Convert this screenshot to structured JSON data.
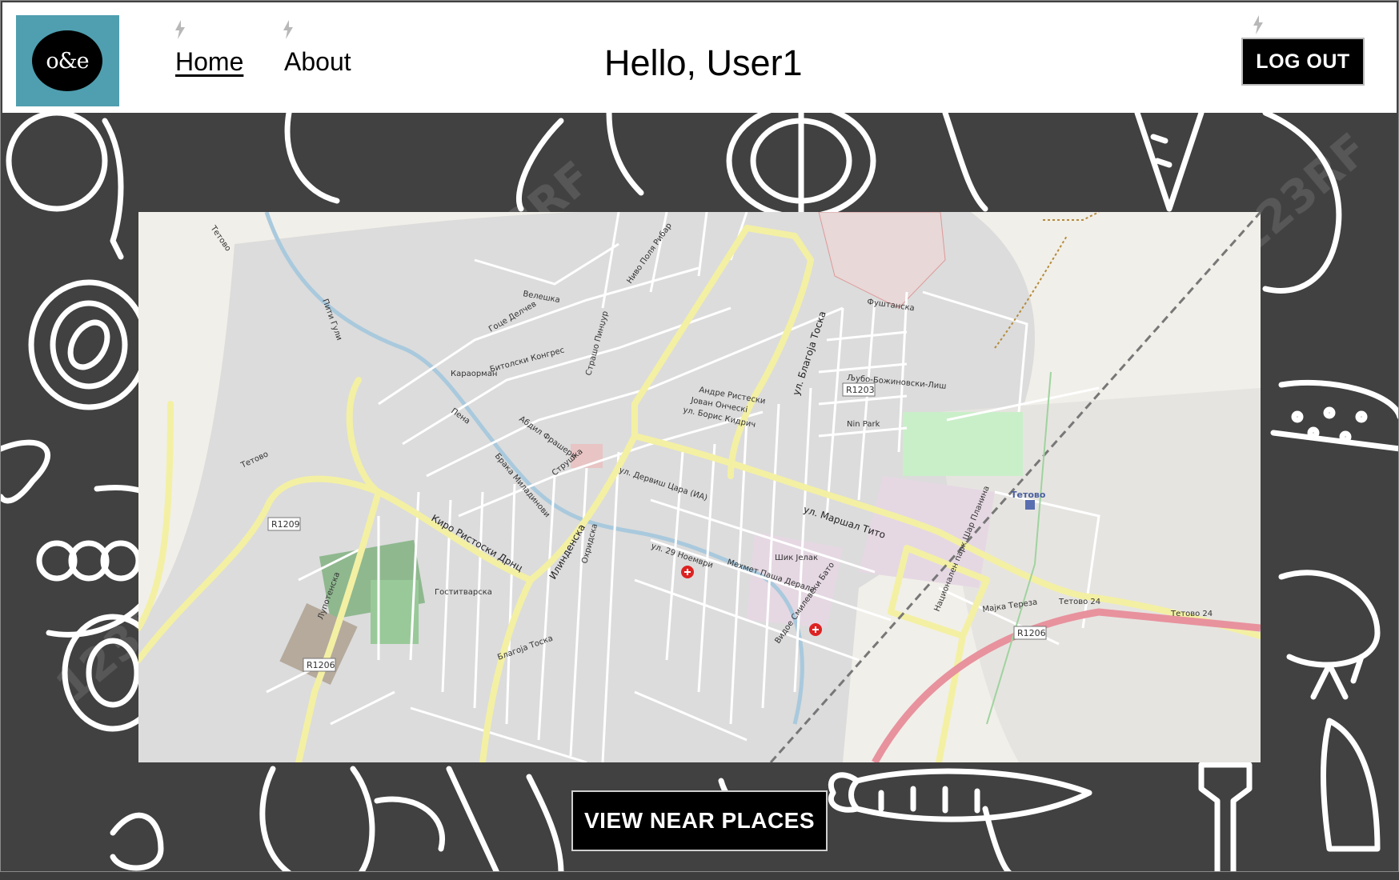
{
  "header": {
    "logo_text": "o&e",
    "nav": {
      "home": "Home",
      "about": "About"
    },
    "greeting": "Hello, User1",
    "logout_label": "LOG OUT"
  },
  "map": {
    "place": "Тетово",
    "streets": [
      "ул. Маршал Тито",
      "ул. 29 Ноември",
      "Илинденска",
      "Киро Ристоски Дрнц",
      "Мехмет Паша Дерала",
      "Видое Смилевски Бато",
      "ул. Благоја Тоска",
      "Гоце Делчев",
      "ул. Борис Кидрич",
      "Андре Ристески",
      "Јован Онческі",
      "Абдил Фрашери",
      "ул. Дервиш Цара (ИА)",
      "Брака Миладинови",
      "Фуштанска",
      "Љубо-Божиновски-Лиш",
      "Гоститварска",
      "Струшка",
      "Охридска",
      "Лупотенска",
      "Мајка Тереза",
      "Шик Јелак",
      "Страшо Пинџур",
      "Ниво Поля Рибар",
      "Велешка",
      "Битолски Конгрес",
      "Караорман",
      "Пити Гули",
      "Национален парк Шар Планина",
      "Благоја Тоска",
      "Пена"
    ],
    "park": "Nin Park",
    "routes": [
      "R1209",
      "R1206",
      "R1203",
      "R1206"
    ],
    "ring_road": [
      "Тетово 24",
      "Тетово 24"
    ],
    "station": "Тетово"
  },
  "actions": {
    "view_near": "VIEW NEAR PLACES"
  }
}
